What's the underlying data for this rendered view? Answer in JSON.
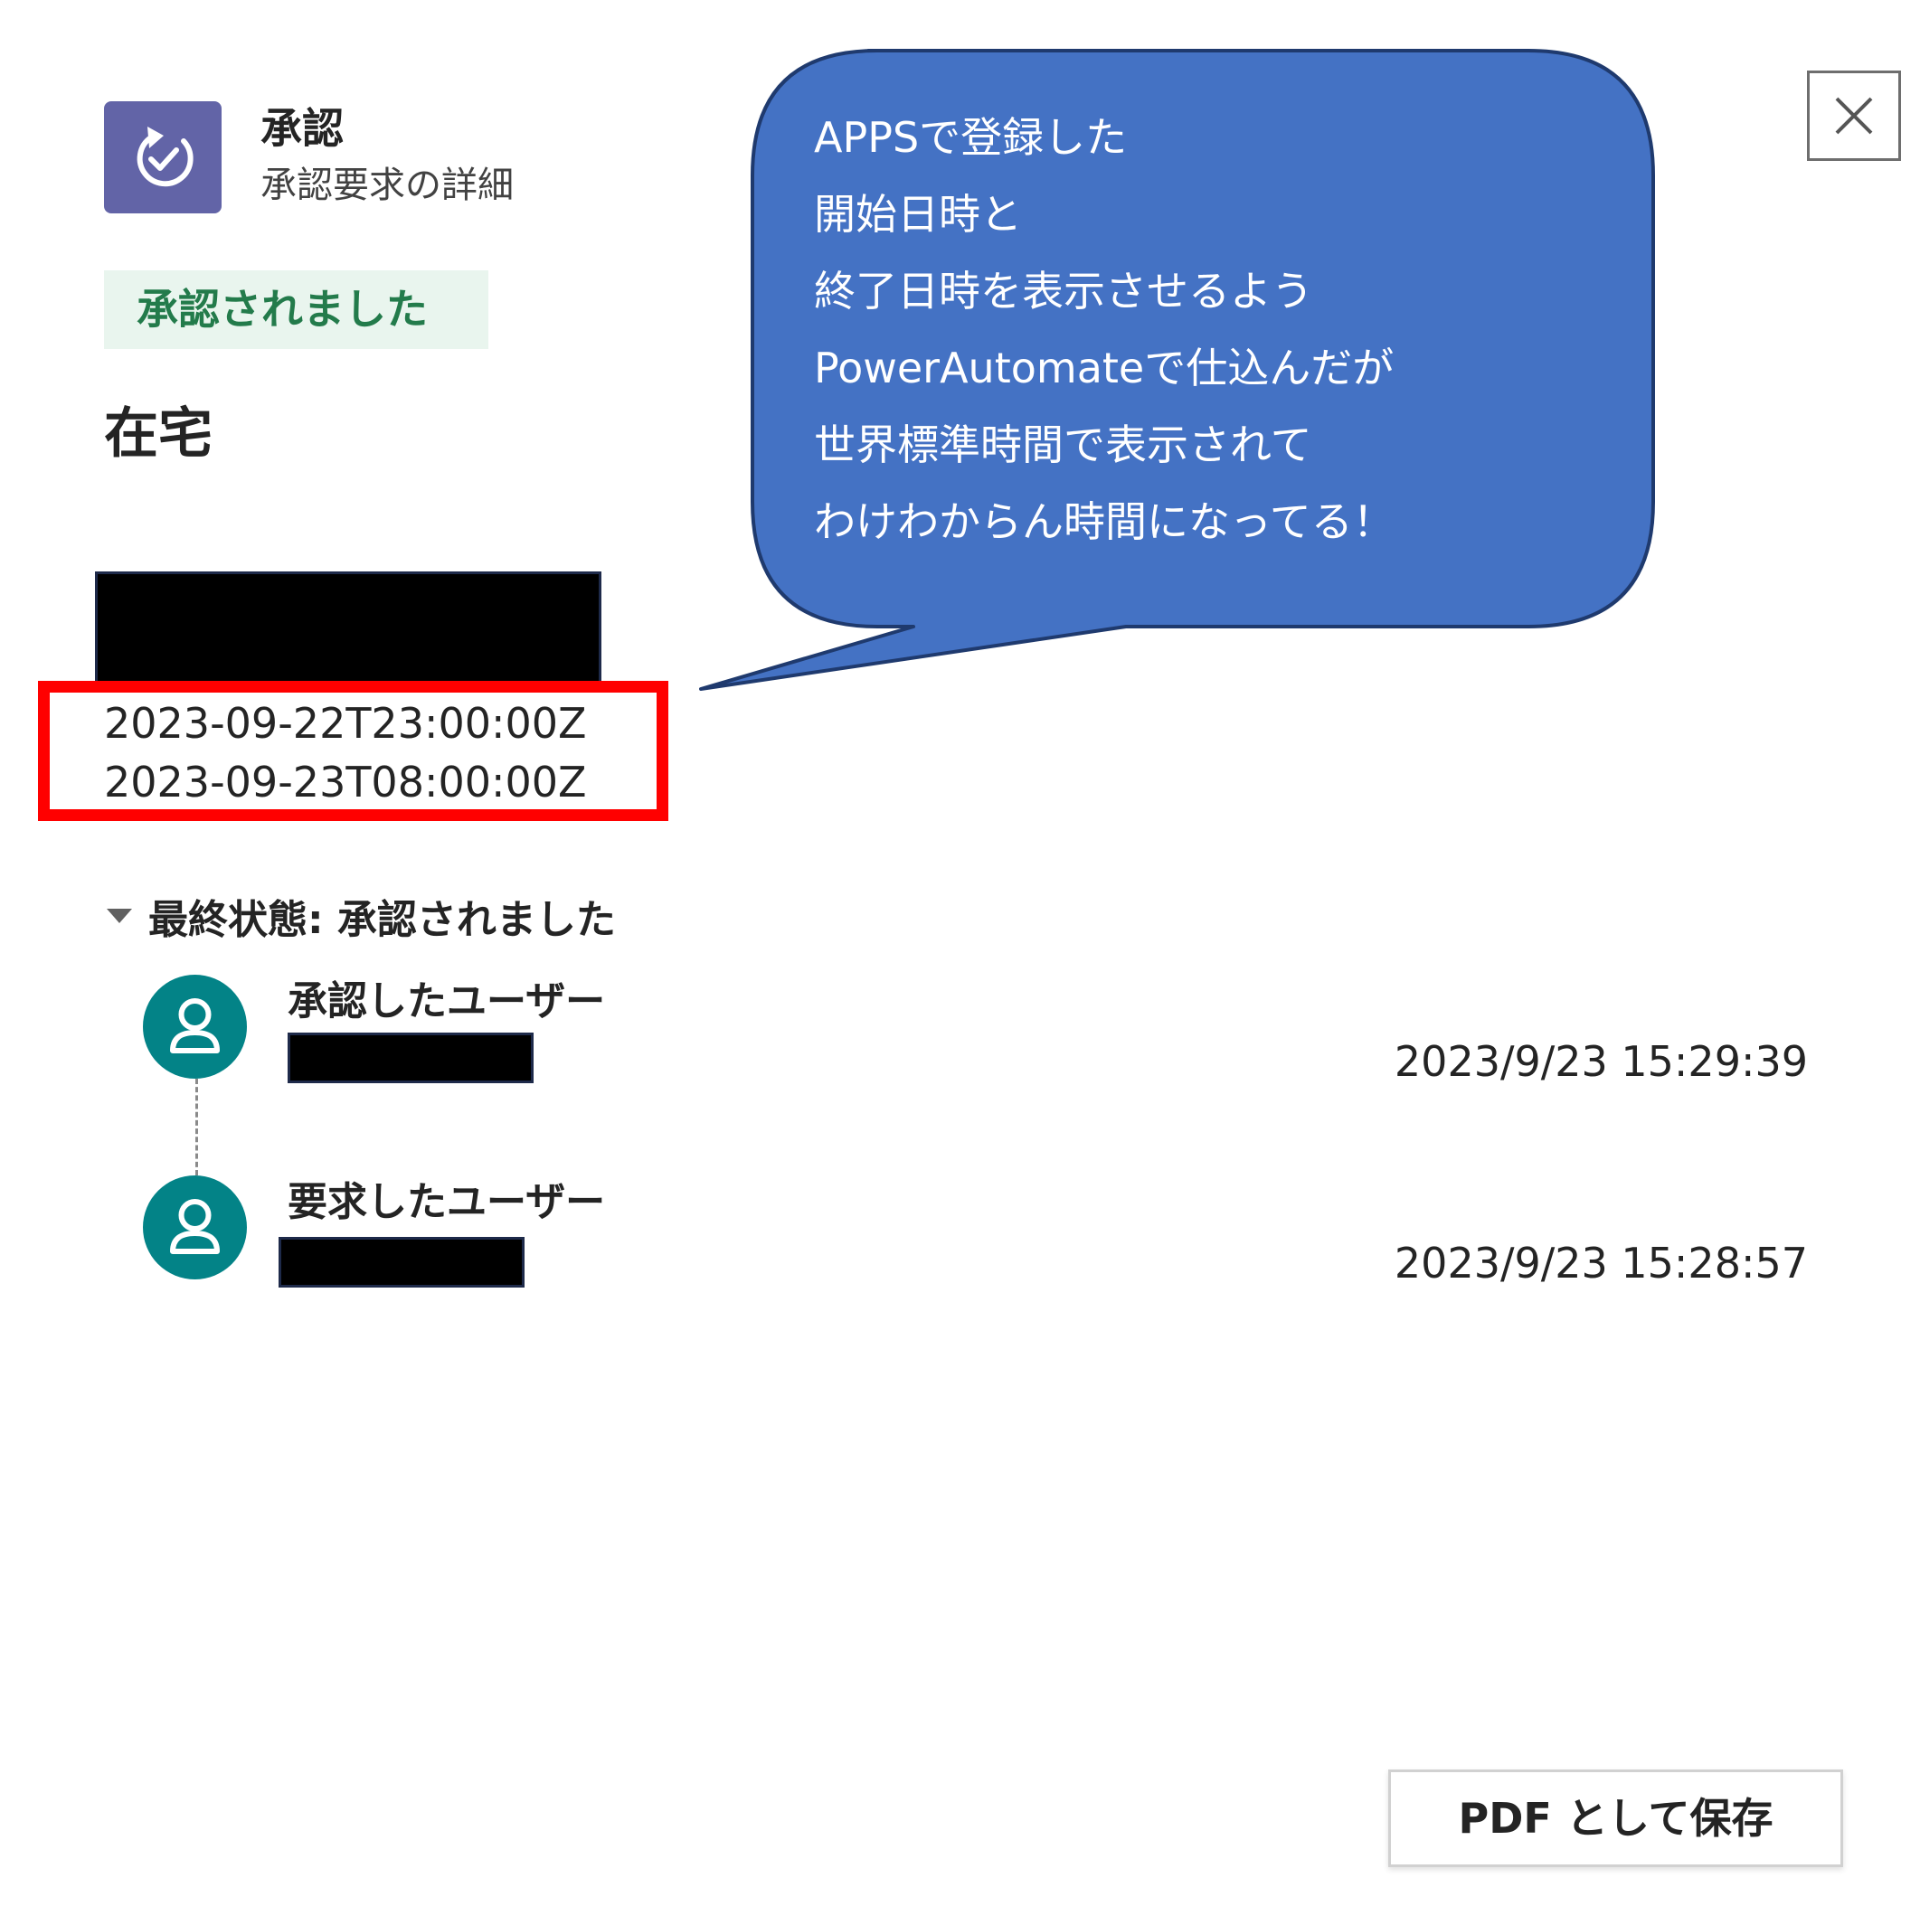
{
  "header": {
    "app_name": "承認",
    "subtitle": "承認要求の詳細",
    "app_icon": "approvals-icon",
    "accent_color": "#6264a7"
  },
  "status": {
    "label": "承認されました",
    "color": "#237b4b",
    "background": "#e9f5ee"
  },
  "request": {
    "title": "在宅",
    "start_datetime": "2023-09-22T23:00:00Z",
    "end_datetime": "2023-09-23T08:00:00Z"
  },
  "callout": {
    "lines": [
      "APPSで登録した",
      "開始日時と",
      "終了日時を表示させるよう",
      "PowerAutomateで仕込んだが",
      "世界標準時間で表示されて",
      "わけわからん時間になってる！"
    ],
    "fill_color": "#4472c4",
    "highlight_color": "#ff0000"
  },
  "history": {
    "final_status_label": "最終状態: 承認されました",
    "entries": [
      {
        "role": "承認したユーザー",
        "timestamp": "2023/9/23 15:29:39",
        "icon": "person-icon"
      },
      {
        "role": "要求したユーザー",
        "timestamp": "2023/9/23 15:28:57",
        "icon": "person-icon"
      }
    ],
    "avatar_color": "#038387"
  },
  "footer": {
    "pdf_button_label": "PDF として保存"
  },
  "icons": {
    "close": "close-icon",
    "collapse": "triangle-down-icon"
  }
}
